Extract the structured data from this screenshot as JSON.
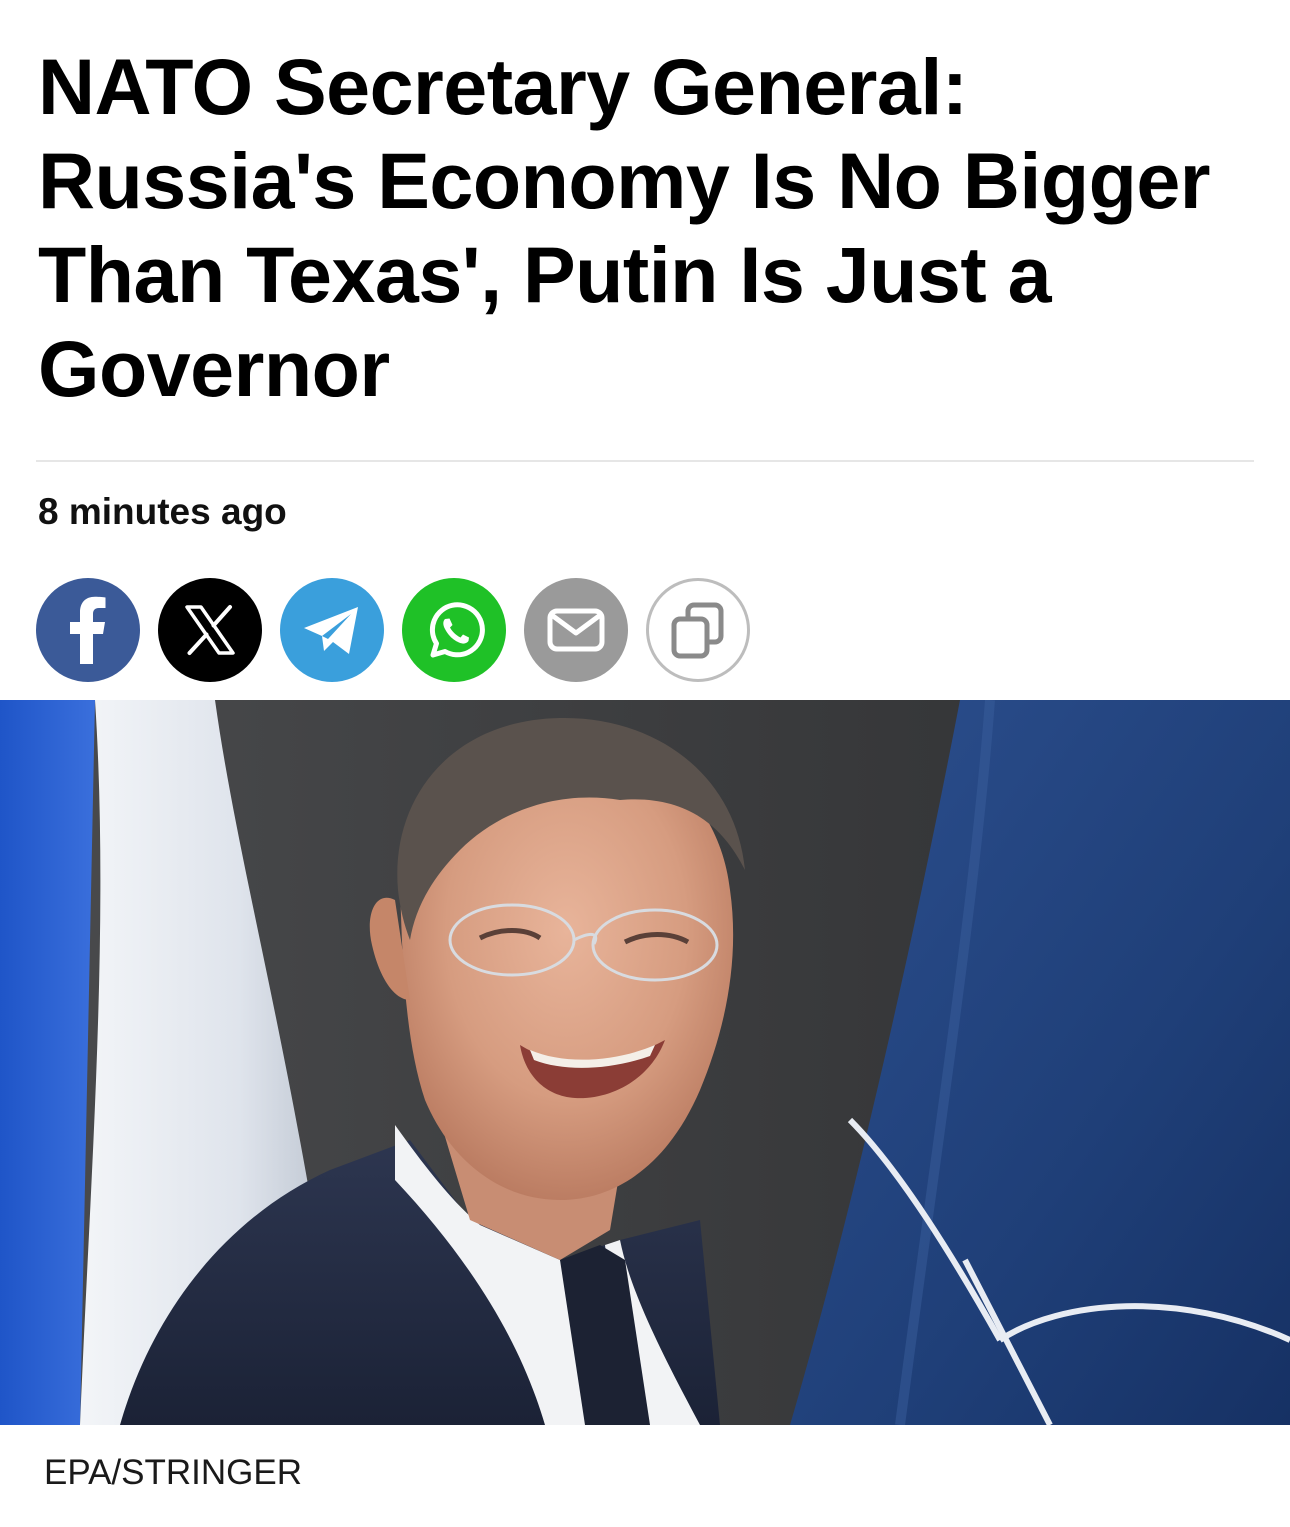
{
  "article": {
    "headline": "NATO Secretary General: Russia's Economy Is No Bigger Than Texas', Putin Is Just a Governor",
    "timestamp": "8 minutes ago",
    "photo_caption": "EPA/STRINGER"
  },
  "share": [
    {
      "name": "facebook",
      "icon": "facebook-icon",
      "color": "#3b5a98"
    },
    {
      "name": "x",
      "icon": "x-icon",
      "color": "#000000"
    },
    {
      "name": "telegram",
      "icon": "telegram-icon",
      "color": "#3a9fdc"
    },
    {
      "name": "whatsapp",
      "icon": "whatsapp-icon",
      "color": "#1fc127"
    },
    {
      "name": "email",
      "icon": "email-icon",
      "color": "#9a9a9a"
    },
    {
      "name": "copy-link",
      "icon": "copy-icon",
      "color": "#ffffff"
    }
  ]
}
